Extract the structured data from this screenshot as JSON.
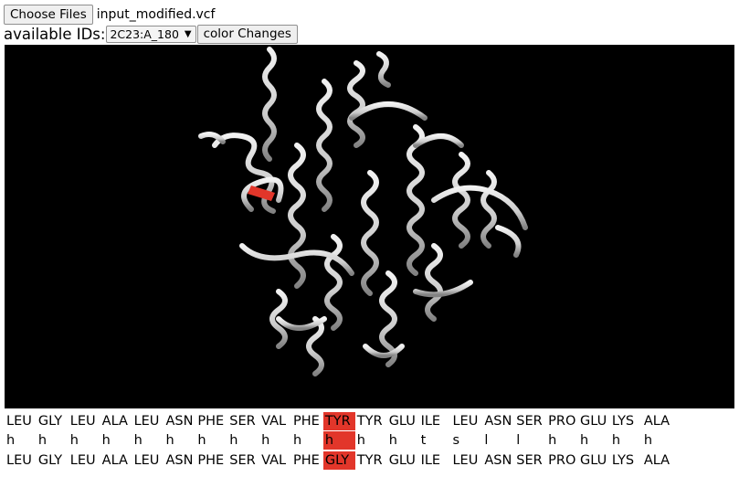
{
  "file": {
    "choose_label": "Choose Files",
    "filename": "input_modified.vcf"
  },
  "ids": {
    "label": "available IDs:",
    "selected": "2C23:A_180",
    "color_changes_label": "color Changes"
  },
  "viewer": {
    "background": "#000000",
    "highlight_color": "#e2362a"
  },
  "sequence": {
    "original": [
      "LEU",
      "GLY",
      "LEU",
      "ALA",
      "LEU",
      "ASN",
      "PHE",
      "SER",
      "VAL",
      "PHE",
      "TYR",
      "TYR",
      "GLU",
      "ILE",
      "LEU",
      "ASN",
      "SER",
      "PRO",
      "GLU",
      "LYS",
      "ALA"
    ],
    "structure": [
      "h",
      "h",
      "h",
      "h",
      "h",
      "h",
      "h",
      "h",
      "h",
      "h",
      "h",
      "h",
      "h",
      "t",
      "s",
      "l",
      "l",
      "h",
      "h",
      "h",
      "h"
    ],
    "modified": [
      "LEU",
      "GLY",
      "LEU",
      "ALA",
      "LEU",
      "ASN",
      "PHE",
      "SER",
      "VAL",
      "PHE",
      "GLY",
      "TYR",
      "GLU",
      "ILE",
      "LEU",
      "ASN",
      "SER",
      "PRO",
      "GLU",
      "LYS",
      "ALA"
    ],
    "highlight_index": 10
  }
}
